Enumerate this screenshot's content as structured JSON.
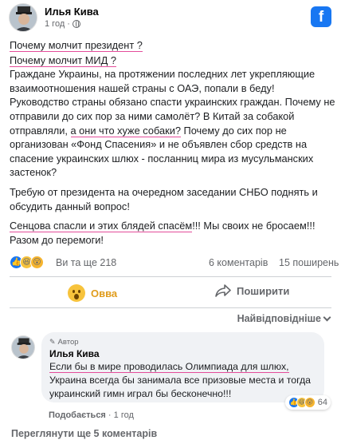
{
  "post": {
    "author": "Илья Кива",
    "time": "1 год",
    "lines": {
      "l1": "Почему молчит президент ?",
      "l2": "Почему молчит МИД ?",
      "p1": "Граждане Украины, на протяжении последних лет укрепляющие взаимоотношения нашей страны с ОАЭ, попали в беду! Руководство страны обязано спасти украинских граждан. Почему не отправили до сих пор за ними самолёт? В Китай за собакой отправляли, ",
      "p1_hl": "а они что хуже собаки?",
      "p1_tail": " Почему до сих пор не организован «Фонд Спасения» и не объявлен сбор средств на спасение украинских шлюх - посланниц мира из мусульманских застенок?",
      "p2": "Требую от президента на очередном заседании СНБО поднять и обсудить данный вопрос!",
      "p3_hl": "Сенцова спасли и этих блядей спасём",
      "p3_tail": "!!! Мы своих не бросаем!!! Разом до перемоги!"
    }
  },
  "reactions": {
    "summary": "Ви та ще 218",
    "comments": "6 коментарів",
    "shares": "15 поширень"
  },
  "actions": {
    "react_label": "Овва",
    "share_label": "Поширити"
  },
  "sort": {
    "label": "Найвідповідніше"
  },
  "comment": {
    "badge": "Автор",
    "author": "Илья Кива",
    "text_hl": "Если бы в мире проводилась Олимпиада для шлюх,",
    "text_tail": " Украина всегда бы занимала все призовые места и тогда украинский гимн играл бы бесконечно!!!",
    "react_count": "64",
    "like_label": "Подобається",
    "time": "1 год"
  },
  "more_comments": "Переглянути ще 5 коментарів",
  "colors": {
    "underline": "#e44d9a",
    "facebook_blue": "#1877f2",
    "wow_gold": "#e09c1b"
  }
}
